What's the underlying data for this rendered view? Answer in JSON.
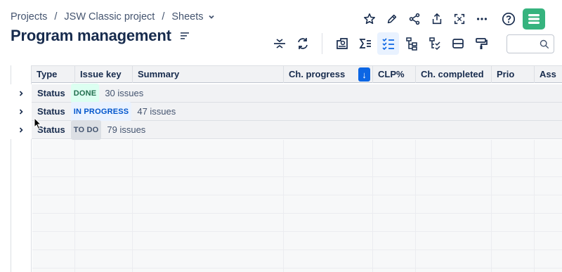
{
  "breadcrumb": {
    "items": [
      "Projects",
      "JSW Classic project",
      "Sheets"
    ],
    "sep": "/"
  },
  "page": {
    "title": "Program management"
  },
  "table": {
    "columns": [
      "Type",
      "Issue key",
      "Summary",
      "Ch. progress",
      "CLP%",
      "Ch. completed",
      "Prio",
      "Ass"
    ],
    "sort_indicator": "↓",
    "groups": [
      {
        "field": "Status",
        "status": "DONE",
        "count": "30 issues",
        "color": "#216e4e",
        "bg": "#dcfff1"
      },
      {
        "field": "Status",
        "status": "IN PROGRESS",
        "count": "47 issues",
        "color": "#0055cc",
        "bg": "#e9f2ff"
      },
      {
        "field": "Status",
        "status": "TO DO",
        "count": "79 issues",
        "color": "#44546f",
        "bg": "#dcdfe4"
      }
    ]
  },
  "icons": {
    "top": [
      "star-icon",
      "edit-icon",
      "share-icon",
      "export-icon",
      "fullscreen-icon",
      "more-icon",
      "help-icon",
      "app-icon"
    ],
    "toolbar": [
      "collapse-rows-icon",
      "refresh-icon",
      "dashboard-icon",
      "sum-icon",
      "checklist-icon",
      "hierarchy-icon",
      "hierarchy-check-icon",
      "row-height-icon",
      "format-painter-icon"
    ],
    "search": "search-icon"
  },
  "colors": {
    "accent": "#0c66e4",
    "app": "#36b37e"
  }
}
